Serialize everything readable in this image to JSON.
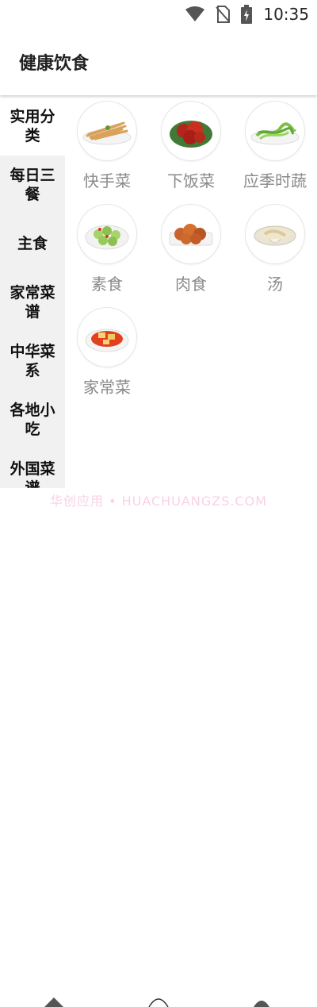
{
  "status": {
    "time": "10:35",
    "icons": [
      "wifi-icon",
      "no-sim-icon",
      "battery-charging-icon"
    ]
  },
  "app": {
    "title": "健康饮食"
  },
  "sidebar": {
    "items": [
      {
        "label": "实用分类",
        "active": true
      },
      {
        "label": "每日三餐",
        "active": false
      },
      {
        "label": "主食",
        "active": false
      },
      {
        "label": "家常菜谱",
        "active": false
      },
      {
        "label": "中华菜系",
        "active": false
      },
      {
        "label": "各地小吃",
        "active": false
      },
      {
        "label": "外国菜谱",
        "active": false
      }
    ]
  },
  "categories": [
    {
      "label": "快手菜",
      "icon": "quick-dish-icon"
    },
    {
      "label": "下饭菜",
      "icon": "rice-dish-icon"
    },
    {
      "label": "应季时蔬",
      "icon": "seasonal-vegetable-icon"
    },
    {
      "label": "素食",
      "icon": "vegetarian-dish-icon"
    },
    {
      "label": "肉食",
      "icon": "meat-dish-icon"
    },
    {
      "label": "汤",
      "icon": "soup-icon"
    },
    {
      "label": "家常菜",
      "icon": "home-dish-icon"
    }
  ],
  "watermark": "华创应用 • HUACHUANGZS.COM",
  "colors": {
    "sidebar_bg": "#f1f1f1",
    "label_gray": "#8a8a8a"
  }
}
